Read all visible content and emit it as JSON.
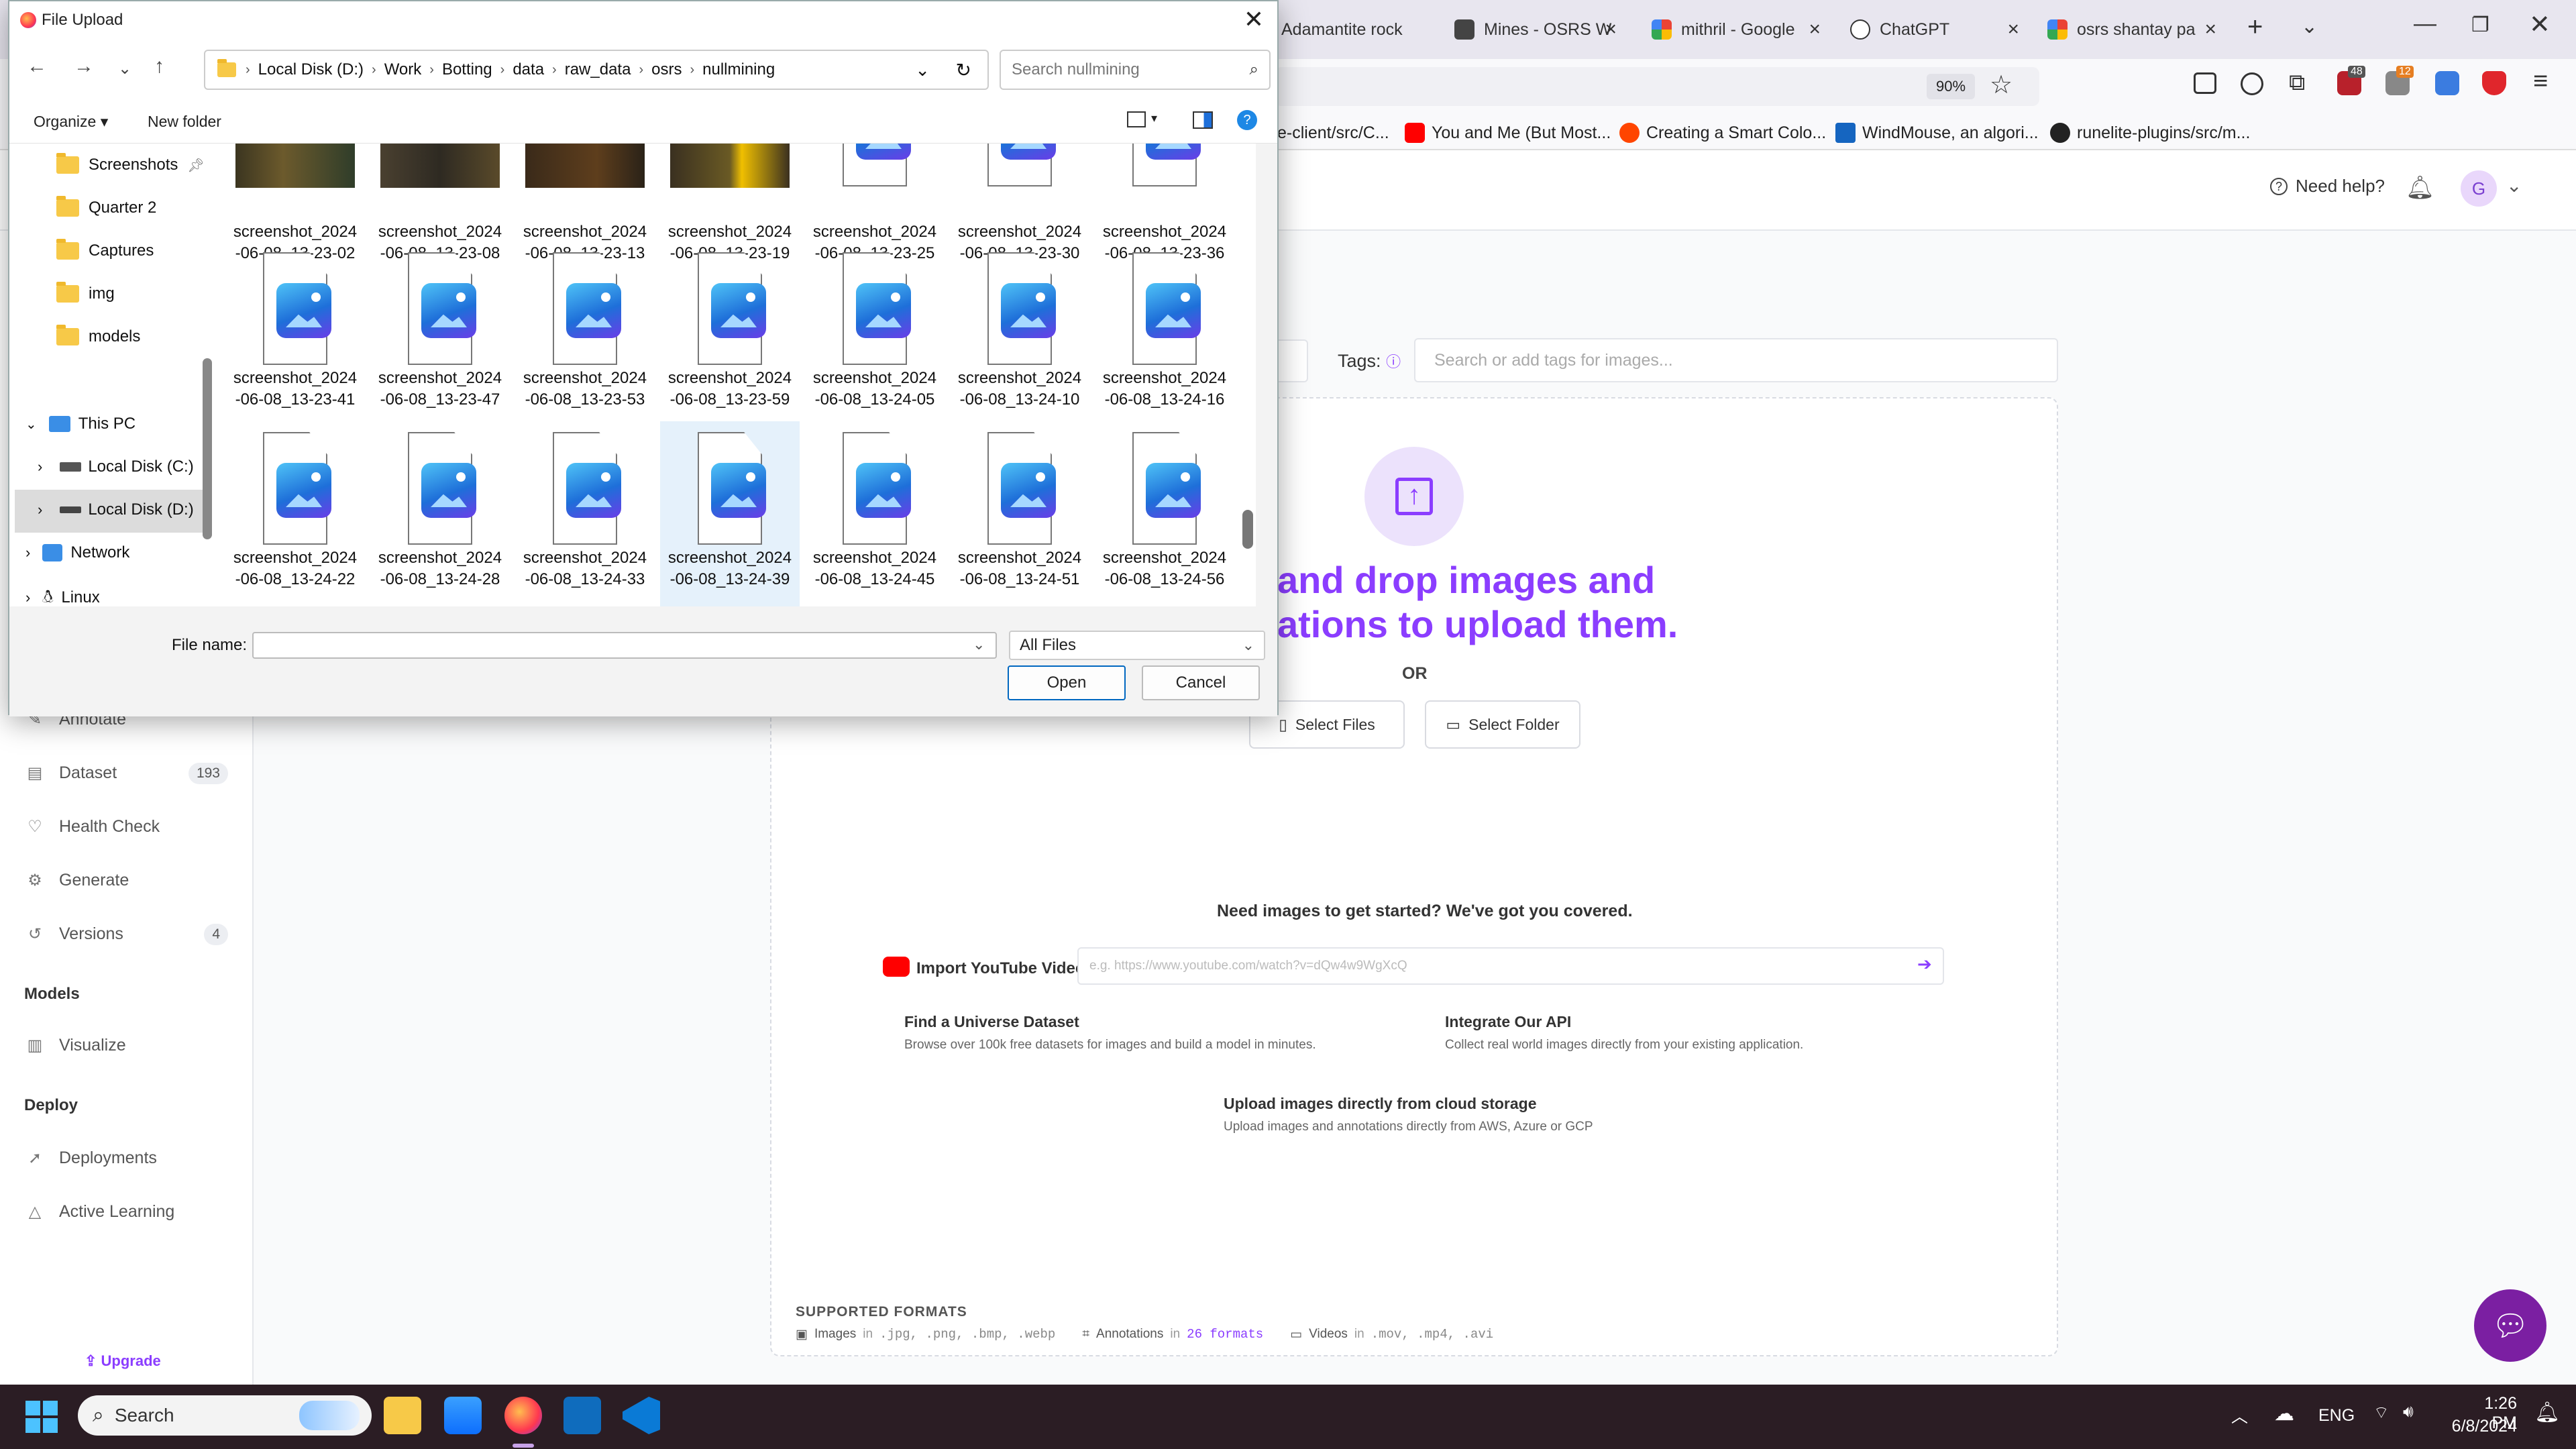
{
  "browser": {
    "tabs": [
      {
        "label": "Adamantite rock"
      },
      {
        "label": "Mines - OSRS W"
      },
      {
        "label": "mithril - Google"
      },
      {
        "label": "ChatGPT"
      },
      {
        "label": "osrs shantay pa"
      }
    ],
    "zoom": "90%",
    "badges": {
      "ext1": "48",
      "ext2": "12"
    },
    "bookmarks": [
      {
        "label": "e-client/src/C..."
      },
      {
        "label": "You and Me (But Most..."
      },
      {
        "label": "Creating a Smart Colo..."
      },
      {
        "label": "WindMouse, an algori..."
      },
      {
        "label": "runelite-plugins/src/m..."
      }
    ]
  },
  "app": {
    "need_help": "Need help?",
    "avatar_initial": "G",
    "tags_label": "Tags:",
    "tags_placeholder": "Search or add tags for images...",
    "drop_title_line1": "and drop images and",
    "drop_title_line2": "ations to upload them.",
    "or": "OR",
    "select_files": "Select Files",
    "select_folder": "Select Folder",
    "need_images": "Need images to get started? We've got you covered.",
    "youtube_label": "Import YouTube Video:",
    "youtube_placeholder": "e.g. https://www.youtube.com/watch?v=dQw4w9WgXcQ",
    "universe_title": "Find a Universe Dataset",
    "universe_desc": "Browse over 100k free datasets for images and build a model in minutes.",
    "api_title": "Integrate Our API",
    "api_desc": "Collect real world images directly from your existing application.",
    "cloud_title": "Upload images directly from cloud storage",
    "cloud_desc": "Upload images and annotations directly from AWS, Azure or GCP",
    "supported_formats": "SUPPORTED FORMATS",
    "fmt_images": "Images",
    "fmt_images_in": "in",
    "fmt_images_list": ".jpg, .png, .bmp, .webp",
    "fmt_annotations": "Annotations",
    "fmt_annotations_in": "in",
    "fmt_annotations_count": "26 formats",
    "fmt_videos": "Videos",
    "fmt_videos_in": "in",
    "fmt_videos_list": ".mov, .mp4, .avi",
    "sidebar": {
      "items": [
        {
          "label": "Annotate",
          "icon": "pencil-icon"
        },
        {
          "label": "Dataset",
          "icon": "image-stack-icon",
          "badge": "193"
        },
        {
          "label": "Health Check",
          "icon": "heart-icon"
        },
        {
          "label": "Generate",
          "icon": "gear-icon"
        },
        {
          "label": "Versions",
          "icon": "history-icon",
          "badge": "4"
        }
      ],
      "models_head": "Models",
      "visualize": "Visualize",
      "deploy_head": "Deploy",
      "deployments": "Deployments",
      "active_learning": "Active Learning",
      "upgrade": "Upgrade"
    }
  },
  "dialog": {
    "title": "File Upload",
    "path": [
      "Local Disk (D:)",
      "Work",
      "Botting",
      "data",
      "raw_data",
      "osrs",
      "nullmining"
    ],
    "search_placeholder": "Search nullmining",
    "organize": "Organize",
    "new_folder": "New folder",
    "tree": [
      {
        "label": "Screenshots",
        "pinned": true
      },
      {
        "label": "Quarter 2"
      },
      {
        "label": "Captures"
      },
      {
        "label": "img"
      },
      {
        "label": "models"
      }
    ],
    "this_pc": "This PC",
    "drive_c": "Local Disk (C:)",
    "drive_d": "Local Disk (D:)",
    "network": "Network",
    "linux": "Linux",
    "files_row0": [
      {
        "l1": "screenshot_2024",
        "l2": "-06-08_13-23-02"
      },
      {
        "l1": "screenshot_2024",
        "l2": "-06-08_13-23-08"
      },
      {
        "l1": "screenshot_2024",
        "l2": "-06-08_13-23-13"
      },
      {
        "l1": "screenshot_2024",
        "l2": "-06-08_13-23-19"
      },
      {
        "l1": "screenshot_2024",
        "l2": "-06-08_13-23-25"
      },
      {
        "l1": "screenshot_2024",
        "l2": "-06-08_13-23-30"
      },
      {
        "l1": "screenshot_2024",
        "l2": "-06-08_13-23-36"
      }
    ],
    "files_row1": [
      {
        "l1": "screenshot_2024",
        "l2": "-06-08_13-23-41"
      },
      {
        "l1": "screenshot_2024",
        "l2": "-06-08_13-23-47"
      },
      {
        "l1": "screenshot_2024",
        "l2": "-06-08_13-23-53"
      },
      {
        "l1": "screenshot_2024",
        "l2": "-06-08_13-23-59"
      },
      {
        "l1": "screenshot_2024",
        "l2": "-06-08_13-24-05"
      },
      {
        "l1": "screenshot_2024",
        "l2": "-06-08_13-24-10"
      },
      {
        "l1": "screenshot_2024",
        "l2": "-06-08_13-24-16"
      }
    ],
    "files_row2": [
      {
        "l1": "screenshot_2024",
        "l2": "-06-08_13-24-22"
      },
      {
        "l1": "screenshot_2024",
        "l2": "-06-08_13-24-28"
      },
      {
        "l1": "screenshot_2024",
        "l2": "-06-08_13-24-33"
      },
      {
        "l1": "screenshot_2024",
        "l2": "-06-08_13-24-39"
      },
      {
        "l1": "screenshot_2024",
        "l2": "-06-08_13-24-45"
      },
      {
        "l1": "screenshot_2024",
        "l2": "-06-08_13-24-51"
      },
      {
        "l1": "screenshot_2024",
        "l2": "-06-08_13-24-56"
      }
    ],
    "file_name_label": "File name:",
    "file_name_value": "",
    "file_type": "All Files",
    "open": "Open",
    "cancel": "Cancel"
  },
  "taskbar": {
    "search": "Search",
    "lang": "ENG",
    "time": "1:26 PM",
    "date": "6/8/2024"
  },
  "colors": {
    "accent": "#8b3dff",
    "taskbar": "#2b1d24",
    "selection": "#e5f1fb"
  }
}
